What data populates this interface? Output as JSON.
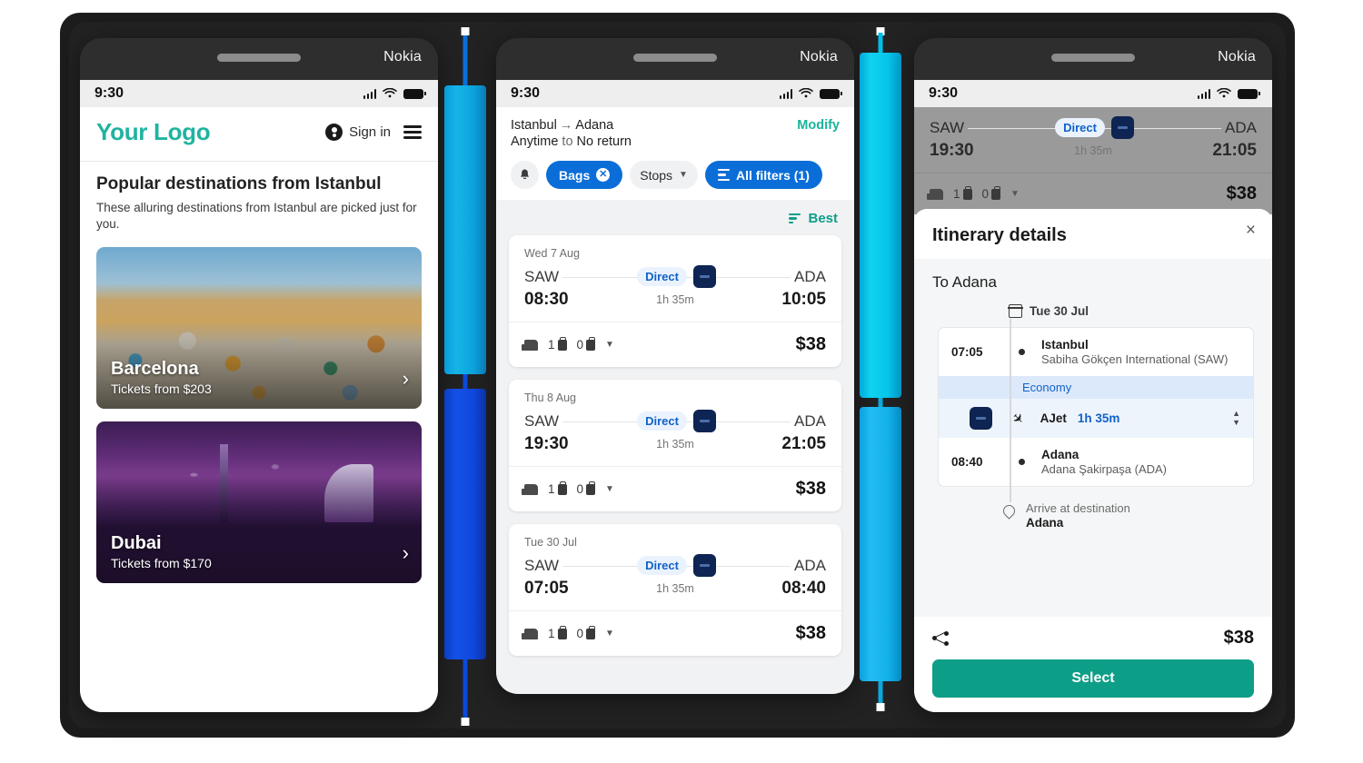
{
  "device": {
    "brand": "Nokia",
    "status_time": "9:30"
  },
  "phone1": {
    "logo": "Your Logo",
    "signin": "Sign in",
    "title": "Popular destinations from Istanbul",
    "subtitle": "These alluring destinations from Istanbul are picked just for you.",
    "destinations": [
      {
        "name": "Barcelona",
        "price": "Tickets from $203"
      },
      {
        "name": "Dubai",
        "price": "Tickets from $170"
      }
    ]
  },
  "phone2": {
    "origin": "Istanbul",
    "arrow": "→",
    "destination": "Adana",
    "depart_label": "Anytime",
    "to_word": "to",
    "return_label": "No return",
    "modify": "Modify",
    "filters": {
      "bags": "Bags",
      "stops": "Stops",
      "all_filters": "All filters (1)"
    },
    "sort_label": "Best",
    "flights": [
      {
        "date": "Wed 7 Aug",
        "from": "SAW",
        "to": "ADA",
        "depart": "08:30",
        "arrive": "10:05",
        "stops": "Direct",
        "duration": "1h 35m",
        "cabin_bags": "1",
        "checked_bags": "0",
        "price": "$38"
      },
      {
        "date": "Thu 8 Aug",
        "from": "SAW",
        "to": "ADA",
        "depart": "19:30",
        "arrive": "21:05",
        "stops": "Direct",
        "duration": "1h 35m",
        "cabin_bags": "1",
        "checked_bags": "0",
        "price": "$38"
      },
      {
        "date": "Tue 30 Jul",
        "from": "SAW",
        "to": "ADA",
        "depart": "07:05",
        "arrive": "08:40",
        "stops": "Direct",
        "duration": "1h 35m",
        "cabin_bags": "1",
        "checked_bags": "0",
        "price": "$38"
      }
    ]
  },
  "phone3": {
    "behind_card": {
      "from": "SAW",
      "to": "ADA",
      "depart": "19:30",
      "arrive": "21:05",
      "stops": "Direct",
      "duration": "1h 35m",
      "cabin_bags": "1",
      "checked_bags": "0",
      "price": "$38"
    },
    "sheet_title": "Itinerary details",
    "close": "×",
    "to_city": "To Adana",
    "date": "Tue 30 Jul",
    "departure": {
      "time": "07:05",
      "city": "Istanbul",
      "airport": "Sabiha Gökçen International (SAW)"
    },
    "cabin": "Economy",
    "flight": {
      "carrier": "AJet",
      "duration": "1h 35m"
    },
    "arrival": {
      "time": "08:40",
      "city": "Adana",
      "airport": "Adana Şakirpaşa (ADA)"
    },
    "arrive_note": {
      "label": "Arrive at destination",
      "city": "Adana"
    },
    "price": "$38",
    "select": "Select"
  },
  "colors": {
    "brand_teal": "#21b3a0",
    "accent_blue": "#0b6ed8",
    "select_green": "#0d9e87",
    "divider_cyan": "#00bfe8",
    "divider_blue": "#0b49d8"
  }
}
